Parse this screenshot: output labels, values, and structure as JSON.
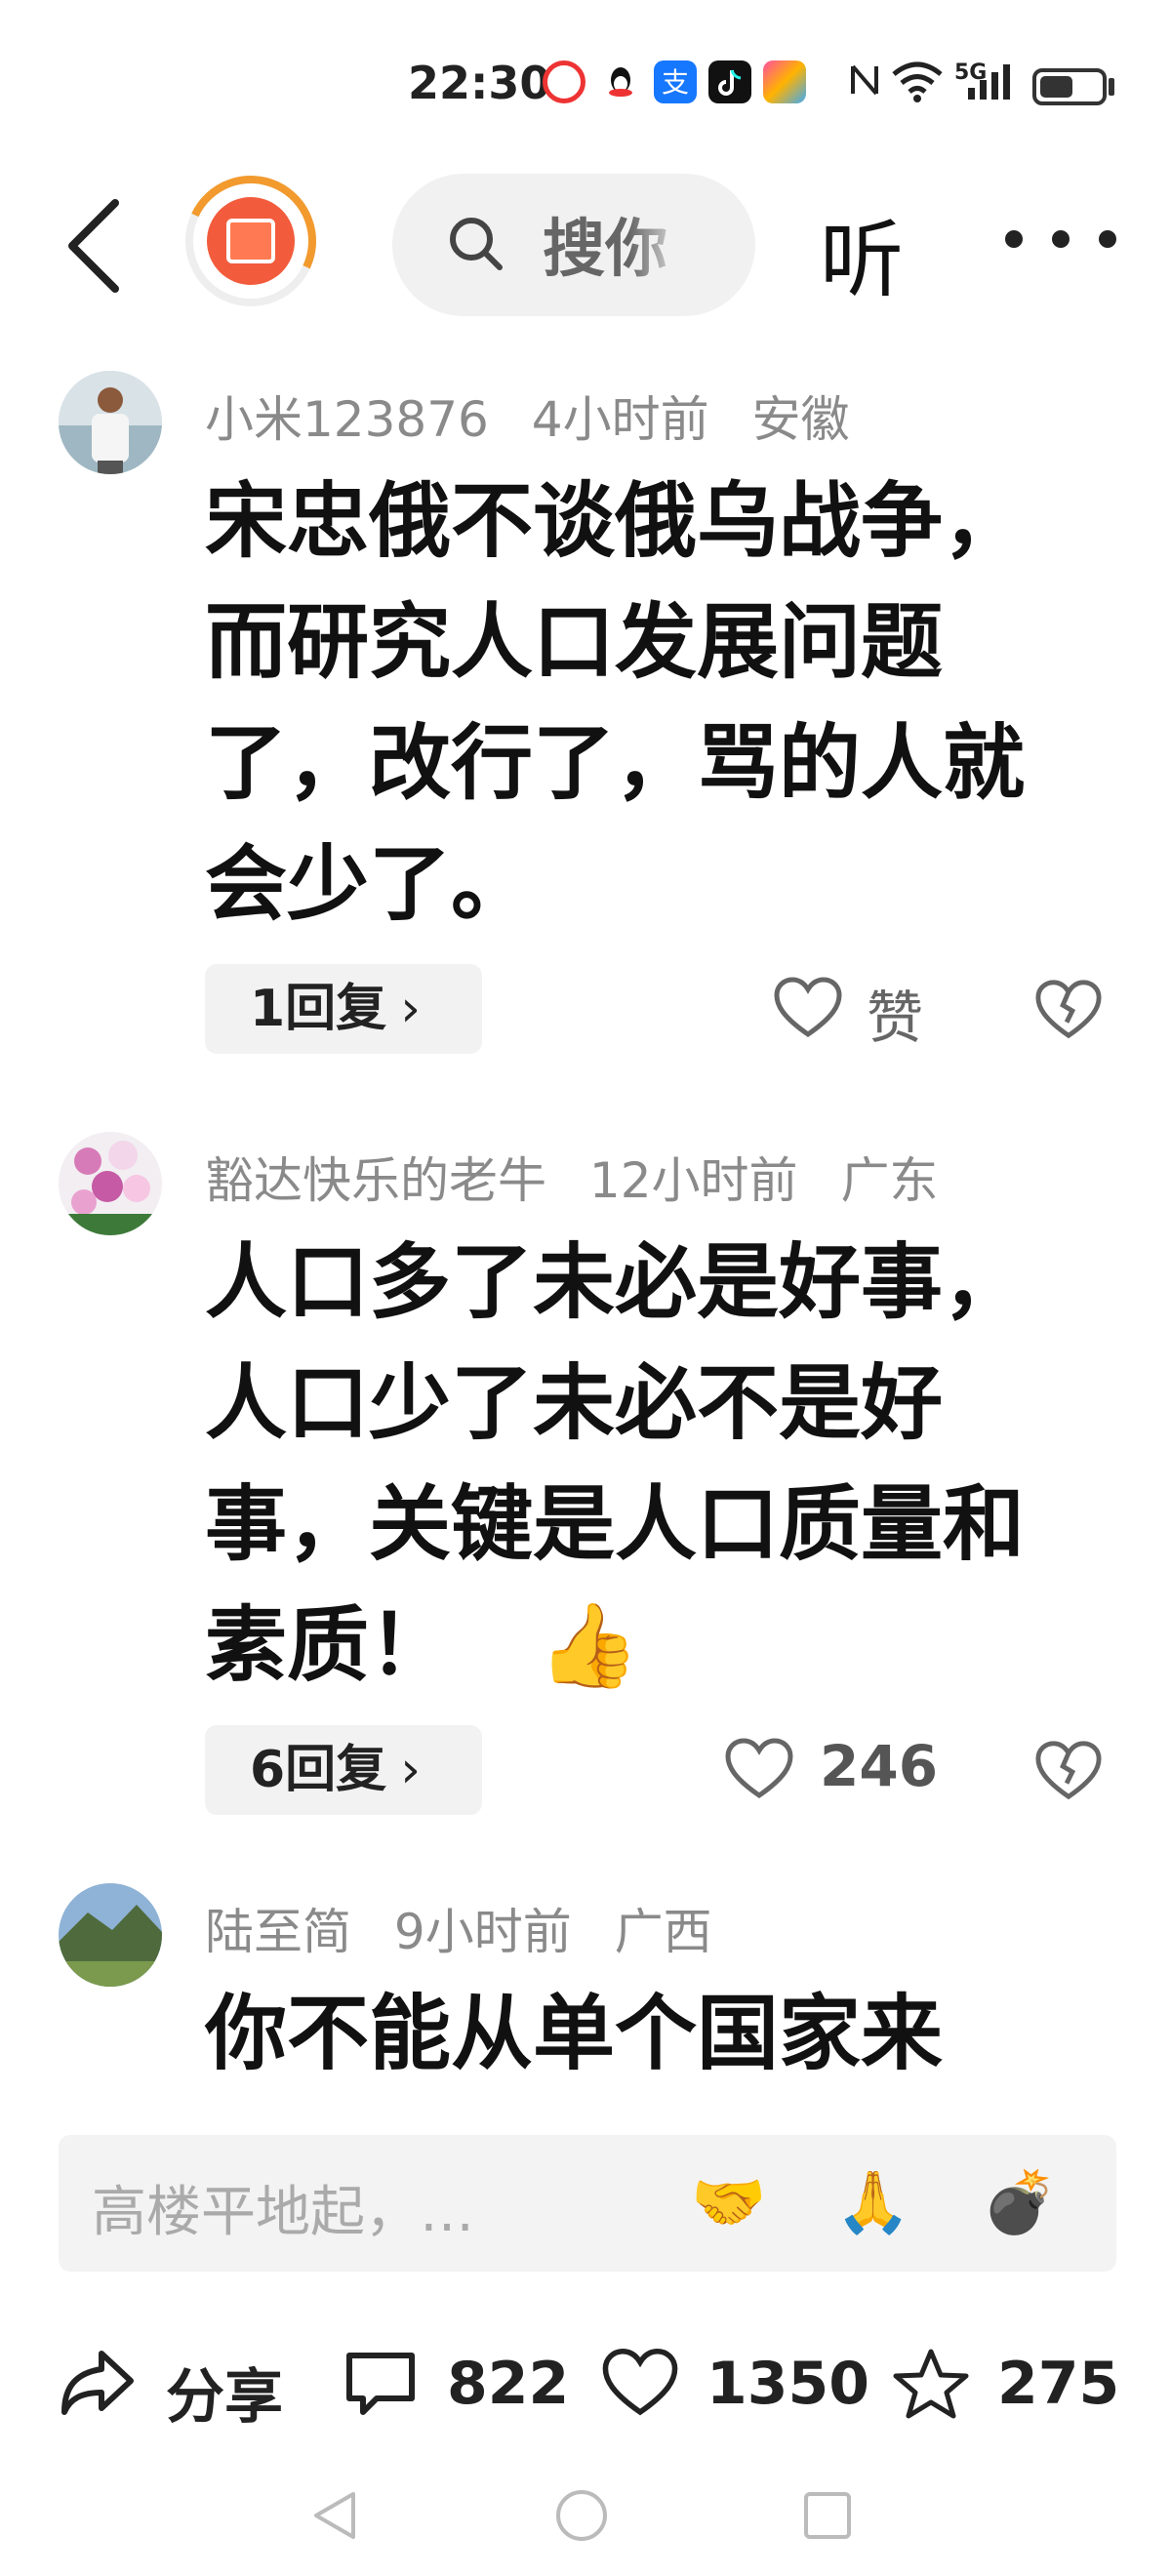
{
  "status_bar": {
    "time": "22:30",
    "network_label": "5G",
    "battery_level": 0.55
  },
  "nav": {
    "search_text": "搜你",
    "listen_label": "听"
  },
  "comments": [
    {
      "user": "小米123876",
      "time": "4小时前",
      "location": "安徽",
      "text": "宋忠俄不谈俄乌战争，而研究人口发展问题了，改行了，骂的人就会少了。",
      "replies_label": "1回复",
      "like_label": "赞"
    },
    {
      "user": "豁达快乐的老牛",
      "time": "12小时前",
      "location": "广东",
      "text": "人口多了未必是好事，人口少了未必不是好事，关键是人口质量和素质！",
      "emoji": "👍",
      "replies_label": "6回复",
      "like_label": "246"
    },
    {
      "user": "陆至简",
      "time": "9小时前",
      "location": "广西",
      "text": "你不能从单个国家来"
    }
  ],
  "input": {
    "placeholder": "高楼平地起，…",
    "emojis": [
      "🤝",
      "🙏",
      "💣"
    ]
  },
  "actions": {
    "share_label": "分享",
    "comments_count": "822",
    "likes_count": "1350",
    "favorites_count": "275"
  },
  "colors": {
    "accent_orange": "#f29a2e",
    "logo_red": "#f25c3c",
    "meta_gray": "#8a8a8a"
  }
}
